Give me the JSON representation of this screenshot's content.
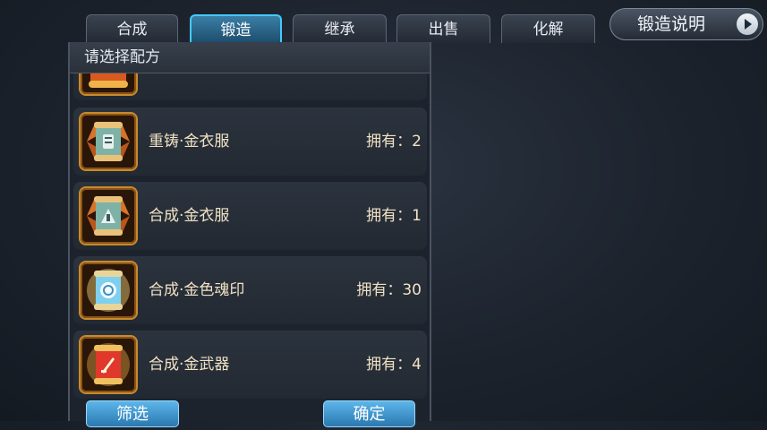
{
  "tabs": [
    {
      "label": "合成"
    },
    {
      "label": "锻造"
    },
    {
      "label": "继承"
    },
    {
      "label": "出售"
    },
    {
      "label": "化解"
    }
  ],
  "active_tab": "锻造",
  "help_button": {
    "label": "锻造说明",
    "icon": "play-arrow-icon"
  },
  "panel": {
    "title": "请选择配方"
  },
  "recipes": [
    {
      "name": "",
      "owned": "",
      "scroll_color": "#d85a1e",
      "icon": "scroll-icon"
    },
    {
      "name": "重铸·金衣服",
      "owned": "拥有：2",
      "scroll_color": "#7fb2a6",
      "icon": "scroll-icon"
    },
    {
      "name": "合成·金衣服",
      "owned": "拥有：1",
      "scroll_color": "#7fb2a6",
      "icon": "scroll-icon"
    },
    {
      "name": "合成·金色魂印",
      "owned": "拥有：30",
      "scroll_color": "#7fd0f0",
      "icon": "scroll-icon"
    },
    {
      "name": "合成·金武器",
      "owned": "拥有：4",
      "scroll_color": "#e0382a",
      "icon": "scroll-icon"
    }
  ],
  "buttons": {
    "filter": "筛选",
    "confirm": "确定"
  },
  "colors": {
    "accent": "#46c8ff",
    "gold_text": "#f1e2c4",
    "frame_gold": "#c98a2b"
  }
}
